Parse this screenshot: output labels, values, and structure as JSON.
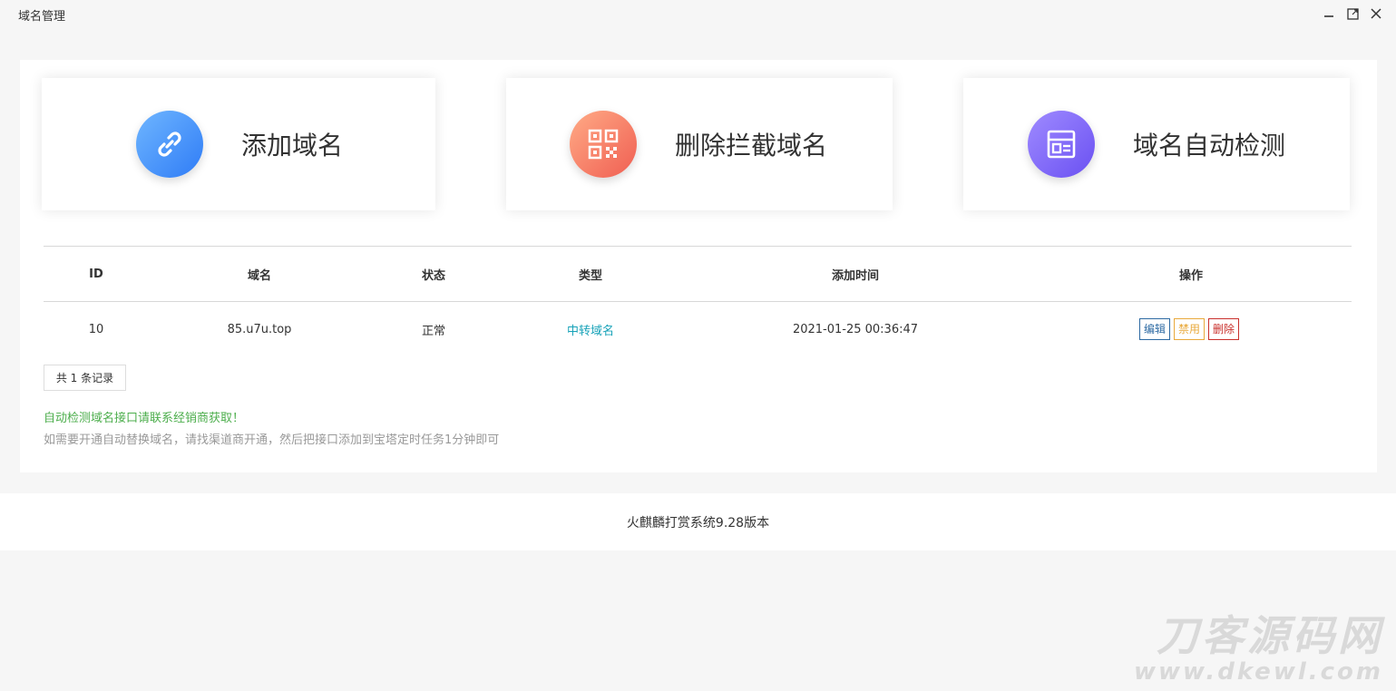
{
  "window": {
    "title": "域名管理",
    "minimize_icon": "minimize-icon",
    "maximize_icon": "maximize-icon",
    "close_icon": "close-icon"
  },
  "cards": [
    {
      "label": "添加域名",
      "icon": "link-icon",
      "color": "#3b8cf8"
    },
    {
      "label": "删除拦截域名",
      "icon": "qrcode-icon",
      "color": "#f26a58"
    },
    {
      "label": "域名自动检测",
      "icon": "list-icon",
      "color": "#7a62f5"
    }
  ],
  "table": {
    "headers": {
      "id": "ID",
      "domain": "域名",
      "status": "状态",
      "type": "类型",
      "time": "添加时间",
      "ops": "操作"
    },
    "rows": [
      {
        "id": "10",
        "domain": "85.u7u.top",
        "status": "正常",
        "type": "中转域名",
        "time": "2021-01-25 00:36:47",
        "ops": {
          "edit": "编辑",
          "disable": "禁用",
          "delete": "删除"
        }
      }
    ]
  },
  "total_records": "共 1 条记录",
  "notes": {
    "line1": "自动检测域名接口请联系经销商获取！",
    "line2": "如需要开通自动替换域名，请找渠道商开通，然后把接口添加到宝塔定时任务1分钟即可"
  },
  "footer": {
    "text": "火麒麟打赏系统9.28版本"
  },
  "watermark": {
    "line1": "刀客源码网",
    "line2": "www.dkewl.com"
  }
}
